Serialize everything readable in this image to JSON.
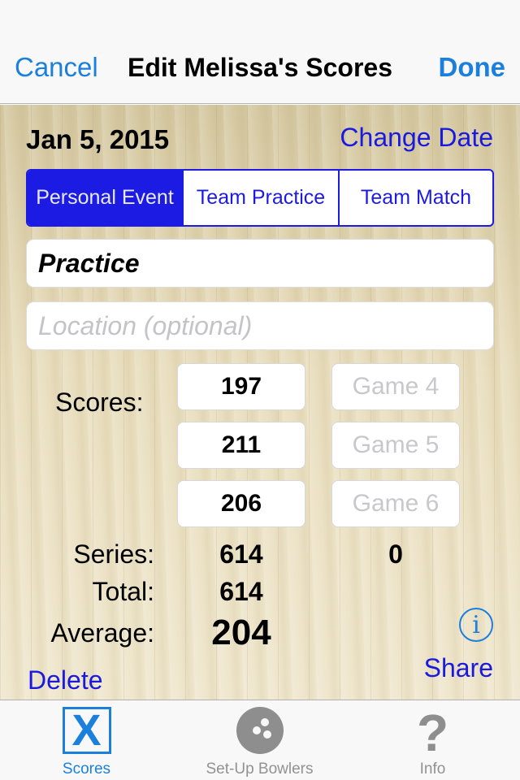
{
  "nav": {
    "cancel_label": "Cancel",
    "title": "Edit Melissa's Scores",
    "done_label": "Done"
  },
  "event": {
    "date": "Jan 5, 2015",
    "change_date_label": "Change Date",
    "segments": [
      "Personal Event",
      "Team Practice",
      "Team Match"
    ],
    "selected_segment": "Personal Event",
    "name_value": "Practice",
    "location_placeholder": "Location (optional)"
  },
  "scores": {
    "label": "Scores:",
    "games": [
      {
        "value": "197"
      },
      {
        "value": "211"
      },
      {
        "value": "206"
      },
      {
        "placeholder": "Game 4"
      },
      {
        "placeholder": "Game 5"
      },
      {
        "placeholder": "Game 6"
      }
    ]
  },
  "stats": {
    "series_label": "Series:",
    "series_value": "614",
    "series2_value": "0",
    "total_label": "Total:",
    "total_value": "614",
    "average_label": "Average:",
    "average_value": "204"
  },
  "actions": {
    "info_icon": "i",
    "share_label": "Share",
    "delete_label": "Delete"
  },
  "tabbar": {
    "tabs": [
      {
        "label": "Scores",
        "icon": "x-box-icon",
        "active": true
      },
      {
        "label": "Set-Up Bowlers",
        "icon": "bowling-ball-icon",
        "active": false
      },
      {
        "label": "Info",
        "icon": "question-mark-icon",
        "active": false
      }
    ]
  },
  "colors": {
    "ios_blue": "#1a7fdd",
    "segment_blue": "#1b1be3",
    "link_blue": "#1a1adf",
    "floor_wood": "#e3d7b4"
  }
}
